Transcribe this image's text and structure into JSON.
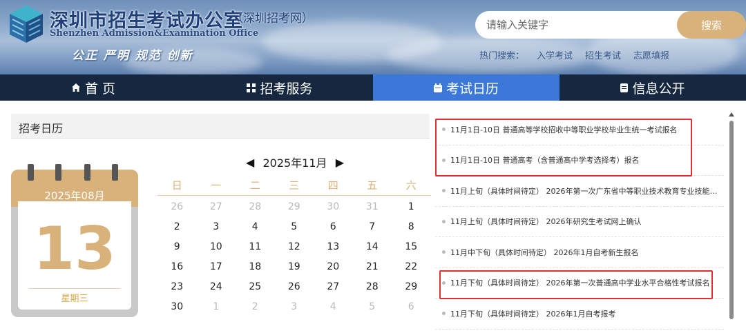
{
  "header": {
    "title": "深圳市招生考试办公室",
    "subtitle": "（深圳招考网）",
    "english_title": "Shenzhen Admission&Examination Office",
    "motto": "公正 严明 规范 创新",
    "logo_icon": "stacked-cubes-logo",
    "search": {
      "placeholder": "请输入关键字",
      "button_label": "搜索"
    },
    "hot_search": {
      "label": "热门搜索：",
      "items": [
        "入学考试",
        "招生考试",
        "志愿填报"
      ]
    }
  },
  "nav": {
    "items": [
      {
        "label": "首 页",
        "icon": "home-icon"
      },
      {
        "label": "招考服务",
        "icon": "grid-icon"
      },
      {
        "label": "考试日历",
        "icon": "calendar-icon",
        "active": true
      },
      {
        "label": "信息公开",
        "icon": "document-icon"
      }
    ]
  },
  "calendar_panel": {
    "title": "招考日历",
    "date_card": {
      "month": "2025年08月",
      "day": "13",
      "weekday": "星期三"
    },
    "month_label": "2025年11月",
    "weekdays": [
      "日",
      "一",
      "二",
      "三",
      "四",
      "五",
      "六"
    ],
    "weeks": [
      [
        "26",
        "27",
        "28",
        "29",
        "30",
        "31",
        "1"
      ],
      [
        "2",
        "3",
        "4",
        "5",
        "6",
        "7",
        "8"
      ],
      [
        "9",
        "10",
        "11",
        "12",
        "13",
        "14",
        "15"
      ],
      [
        "16",
        "17",
        "18",
        "19",
        "20",
        "21",
        "22"
      ],
      [
        "23",
        "24",
        "25",
        "26",
        "27",
        "28",
        "29"
      ],
      [
        "30",
        "1",
        "2",
        "3",
        "4",
        "5",
        "6"
      ]
    ],
    "muted_weeks": [
      [
        true,
        true,
        true,
        true,
        true,
        true,
        false
      ],
      [
        false,
        false,
        false,
        false,
        false,
        false,
        false
      ],
      [
        false,
        false,
        false,
        false,
        false,
        false,
        false
      ],
      [
        false,
        false,
        false,
        false,
        false,
        false,
        false
      ],
      [
        false,
        false,
        false,
        false,
        false,
        false,
        false
      ],
      [
        false,
        true,
        true,
        true,
        true,
        true,
        true
      ]
    ]
  },
  "events": [
    "11月1日-10日 普通高等学校招收中等职业学校毕业生统一考试报名",
    "11月1日-10日 普通高考（含普通高中学考选择考）报名",
    "11月上旬（具体时间待定） 2026年第一次广东省中等职业技术教育专业技能课...",
    "11月上旬（具体时间待定） 2026年研究生考试网上确认",
    "11月中下旬（具体时间待定） 2026年1月自考新生报名",
    "11月下旬（具体时间待定） 2026年第一次普通高中学业水平合格性考试报名",
    "11月下旬（具体时间待定） 2026年1月自考报考"
  ],
  "colors": {
    "accent": "#d8b27a",
    "nav_bg": "#16283f",
    "nav_active": "#3c78d8",
    "highlight": "#e03030"
  }
}
